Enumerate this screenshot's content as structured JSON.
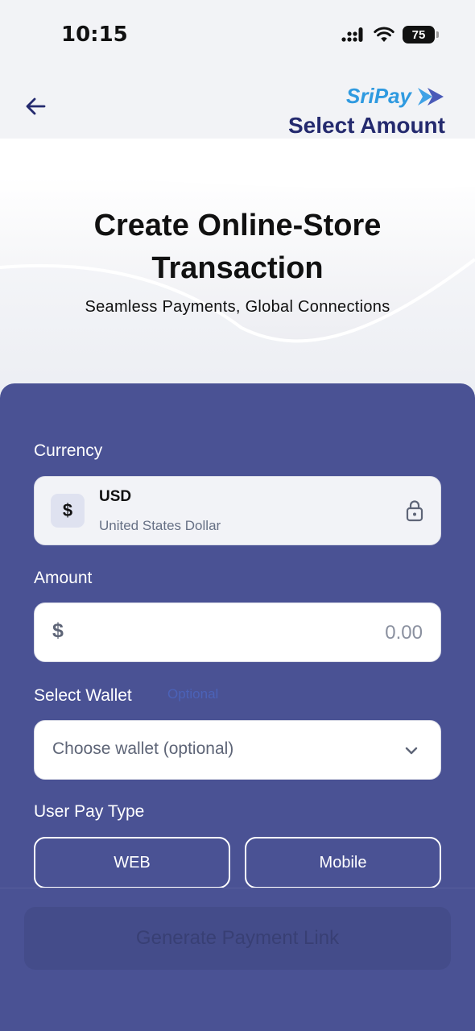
{
  "status_bar": {
    "time": "10:15",
    "battery": "75"
  },
  "header": {
    "brand": "SriPay",
    "title": "Select Amount"
  },
  "hero": {
    "title_line1": "Create Online-Store",
    "title_line2": "Transaction",
    "subtitle": "Seamless Payments, Global Connections"
  },
  "form": {
    "currency": {
      "label": "Currency",
      "symbol": "$",
      "code": "USD",
      "name": "United States Dollar"
    },
    "amount": {
      "label": "Amount",
      "symbol": "$",
      "placeholder": "0.00"
    },
    "wallet": {
      "label": "Select Wallet",
      "optional_tag": "Optional",
      "placeholder": "Choose wallet (optional)"
    },
    "pay_type": {
      "label": "User Pay Type",
      "options": [
        "WEB",
        "Mobile"
      ]
    }
  },
  "actions": {
    "generate_label": "Generate Payment Link"
  },
  "colors": {
    "panel": "#4a5294",
    "header_title": "#242a6e",
    "brand": "#2f9ae0"
  }
}
